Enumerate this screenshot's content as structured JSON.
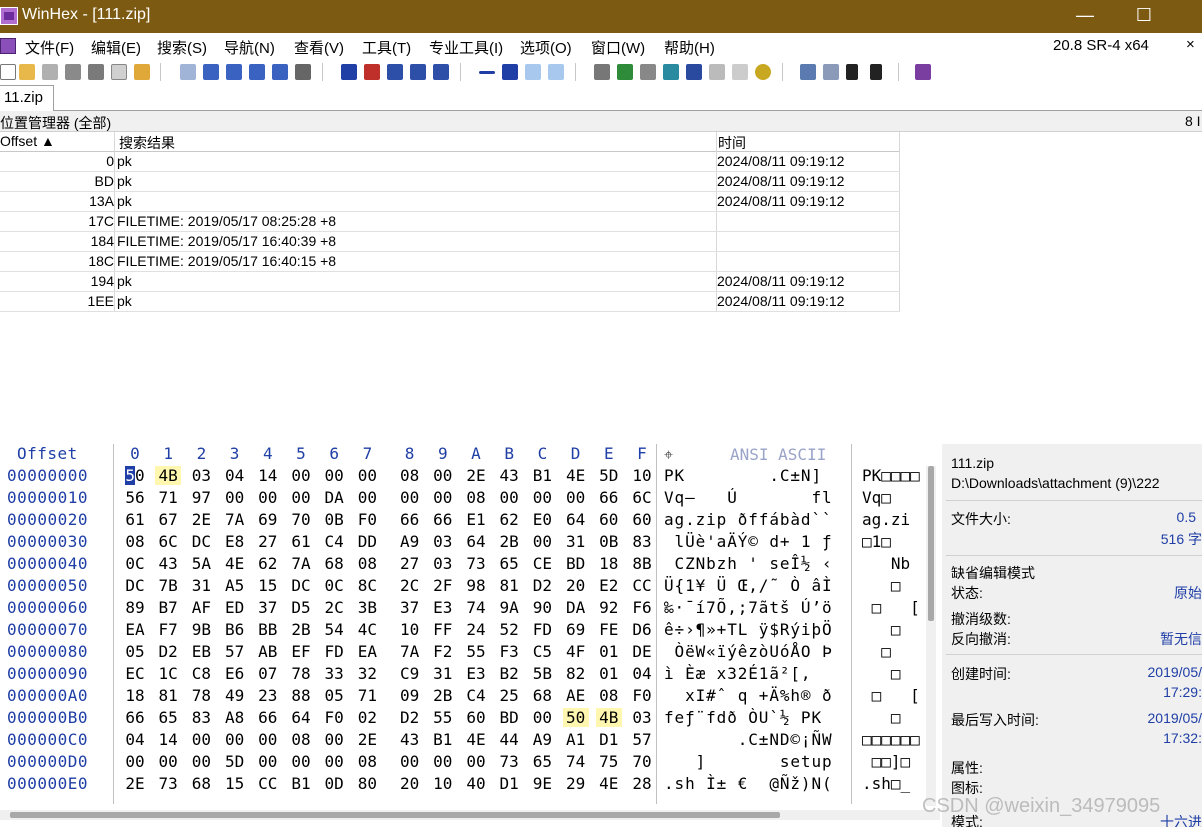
{
  "window": {
    "title": "WinHex - [111.zip]",
    "minimize": "—",
    "maximize": "☐",
    "close": "✕"
  },
  "menu": {
    "items": [
      "文件(F)",
      "编辑(E)",
      "搜索(S)",
      "导航(N)",
      "查看(V)",
      "工具(T)",
      "专业工具(I)",
      "选项(O)",
      "窗口(W)",
      "帮助(H)"
    ],
    "version": "20.8 SR-4 x64",
    "close": "×"
  },
  "toolbar": {
    "icons": [
      "new-file-icon",
      "open-icon",
      "save-icon",
      "print-icon",
      "properties-icon",
      "undo-icon",
      "copy-icon",
      "cut-icon",
      "paste-icon",
      "paste-special-icon",
      "block-icon",
      "find-icon",
      "find-replace-icon",
      "find-hex-icon",
      "replace-hex-icon",
      "find-next-icon",
      "goto-offset-icon",
      "goto-sector-icon",
      "back-icon",
      "forward-icon",
      "disk-editor-icon",
      "ram-editor-icon",
      "hash-icon",
      "calculator-icon",
      "search-tool-icon",
      "options-icon",
      "shield-icon",
      "gear-icon",
      "table-icon",
      "grid-icon",
      "prev-icon",
      "next-icon",
      "book-icon"
    ],
    "colors": {
      "accent_blue": "#1f3ea6",
      "accent_red": "#c0302b",
      "accent_green": "#2e8b3a",
      "purple": "#7a3ea0"
    }
  },
  "tab": {
    "label": "11.zip"
  },
  "position_manager": {
    "label": "位置管理器 (全部)",
    "count": "8 I",
    "columns": {
      "offset": "Offset ▲",
      "result": "搜索结果",
      "time": "时间"
    },
    "rows": [
      {
        "offset": "0",
        "result": "pk",
        "time": "2024/08/11  09:19:12"
      },
      {
        "offset": "BD",
        "result": "pk",
        "time": "2024/08/11  09:19:12"
      },
      {
        "offset": "13A",
        "result": "pk",
        "time": "2024/08/11  09:19:12"
      },
      {
        "offset": "17C",
        "result": "FILETIME: 2019/05/17  08:25:28  +8",
        "time": ""
      },
      {
        "offset": "184",
        "result": "FILETIME: 2019/05/17  16:40:39  +8",
        "time": ""
      },
      {
        "offset": "18C",
        "result": "FILETIME: 2019/05/17  16:40:15  +8",
        "time": ""
      },
      {
        "offset": "194",
        "result": "pk",
        "time": "2024/08/11  09:19:12"
      },
      {
        "offset": "1EE",
        "result": "pk",
        "time": "2024/08/11  09:19:12"
      }
    ]
  },
  "hex": {
    "offset_label": "Offset",
    "columns": [
      "0",
      "1",
      "2",
      "3",
      "4",
      "5",
      "6",
      "7",
      "8",
      "9",
      "A",
      "B",
      "C",
      "D",
      "E",
      "F"
    ],
    "ansi_label": "ANSI ASCII",
    "crosshair": "⌖",
    "rows": [
      {
        "offset": "00000000",
        "bytes": [
          "50",
          "4B",
          "03",
          "04",
          "14",
          "00",
          "00",
          "00",
          "08",
          "00",
          "2E",
          "43",
          "B1",
          "4E",
          "5D",
          "10"
        ],
        "ansi": "PK        .C±N]",
        "ascii": "PK□□□□"
      },
      {
        "offset": "00000010",
        "bytes": [
          "56",
          "71",
          "97",
          "00",
          "00",
          "00",
          "DA",
          "00",
          "00",
          "00",
          "08",
          "00",
          "00",
          "00",
          "66",
          "6C"
        ],
        "ansi": "Vq—   Ú       fl",
        "ascii": "Vq□"
      },
      {
        "offset": "00000020",
        "bytes": [
          "61",
          "67",
          "2E",
          "7A",
          "69",
          "70",
          "0B",
          "F0",
          "66",
          "66",
          "E1",
          "62",
          "E0",
          "64",
          "60",
          "60"
        ],
        "ansi": "ag.zip ðffábàd``",
        "ascii": "ag.zi"
      },
      {
        "offset": "00000030",
        "bytes": [
          "08",
          "6C",
          "DC",
          "E8",
          "27",
          "61",
          "C4",
          "DD",
          "A9",
          "03",
          "64",
          "2B",
          "00",
          "31",
          "0B",
          "83"
        ],
        "ansi": " lÜè'aÄÝ© d+ 1 ƒ",
        "ascii": "□1□"
      },
      {
        "offset": "00000040",
        "bytes": [
          "0C",
          "43",
          "5A",
          "4E",
          "62",
          "7A",
          "68",
          "08",
          "27",
          "03",
          "73",
          "65",
          "CE",
          "BD",
          "18",
          "8B"
        ],
        "ansi": " CZNbzh ' seÎ½ ‹",
        "ascii": "   Nb"
      },
      {
        "offset": "00000050",
        "bytes": [
          "DC",
          "7B",
          "31",
          "A5",
          "15",
          "DC",
          "0C",
          "8C",
          "2C",
          "2F",
          "98",
          "81",
          "D2",
          "20",
          "E2",
          "CC"
        ],
        "ansi": "Ü{1¥ Ü Œ,/˜ Ò âÌ",
        "ascii": "   □"
      },
      {
        "offset": "00000060",
        "bytes": [
          "89",
          "B7",
          "AF",
          "ED",
          "37",
          "D5",
          "2C",
          "3B",
          "37",
          "E3",
          "74",
          "9A",
          "90",
          "DA",
          "92",
          "F6"
        ],
        "ansi": "‰·¯í7Õ,;7ãtš Ú’ö",
        "ascii": " □   ["
      },
      {
        "offset": "00000070",
        "bytes": [
          "EA",
          "F7",
          "9B",
          "B6",
          "BB",
          "2B",
          "54",
          "4C",
          "10",
          "FF",
          "24",
          "52",
          "FD",
          "69",
          "FE",
          "D6"
        ],
        "ansi": "ê÷›¶»+TL ÿ$RýiþÖ",
        "ascii": "   □"
      },
      {
        "offset": "00000080",
        "bytes": [
          "05",
          "D2",
          "EB",
          "57",
          "AB",
          "EF",
          "FD",
          "EA",
          "7A",
          "F2",
          "55",
          "F3",
          "C5",
          "4F",
          "01",
          "DE"
        ],
        "ansi": " ÒëW«ïýêzòUóÅO Þ",
        "ascii": "  □"
      },
      {
        "offset": "00000090",
        "bytes": [
          "EC",
          "1C",
          "C8",
          "E6",
          "07",
          "78",
          "33",
          "32",
          "C9",
          "31",
          "E3",
          "B2",
          "5B",
          "82",
          "01",
          "04"
        ],
        "ansi": "ì Èæ x32É1ã²[‚  ",
        "ascii": "   □"
      },
      {
        "offset": "000000A0",
        "bytes": [
          "18",
          "81",
          "78",
          "49",
          "23",
          "88",
          "05",
          "71",
          "09",
          "2B",
          "C4",
          "25",
          "68",
          "AE",
          "08",
          "F0"
        ],
        "ansi": "  xI#ˆ q +Ä%h® ð",
        "ascii": " □   ["
      },
      {
        "offset": "000000B0",
        "bytes": [
          "66",
          "65",
          "83",
          "A8",
          "66",
          "64",
          "F0",
          "02",
          "D2",
          "55",
          "60",
          "BD",
          "00",
          "50",
          "4B",
          "03"
        ],
        "ansi": "feƒ¨fdð ÒU`½ PK ",
        "ascii": "   □"
      },
      {
        "offset": "000000C0",
        "bytes": [
          "04",
          "14",
          "00",
          "00",
          "00",
          "08",
          "00",
          "2E",
          "43",
          "B1",
          "4E",
          "44",
          "A9",
          "A1",
          "D1",
          "57"
        ],
        "ansi": "       .C±ND©¡ÑW",
        "ascii": "□□□□□□"
      },
      {
        "offset": "000000D0",
        "bytes": [
          "00",
          "00",
          "00",
          "5D",
          "00",
          "00",
          "00",
          "08",
          "00",
          "00",
          "00",
          "73",
          "65",
          "74",
          "75",
          "70"
        ],
        "ansi": "   ]       setup",
        "ascii": " □□]□"
      },
      {
        "offset": "000000E0",
        "bytes": [
          "2E",
          "73",
          "68",
          "15",
          "CC",
          "B1",
          "0D",
          "80",
          "20",
          "10",
          "40",
          "D1",
          "9E",
          "29",
          "4E",
          "28"
        ],
        "ansi": ".sh Ì± €  @Ñž)N(",
        "ascii": ".sh□_"
      }
    ]
  },
  "info_panel": {
    "filename": "111.zip",
    "path": "D:\\Downloads\\attachment (9)\\222",
    "file_size_label": "文件大小:",
    "file_size_value": "0.5",
    "file_size_bytes": "516 字",
    "default_edit_mode": "缺省编辑模式",
    "state_label": "状态:",
    "state_value": "原始",
    "undo_level_label": "撤消级数:",
    "undo_reverse_label": "反向撤消:",
    "undo_reverse_value": "暂无信",
    "created_label": "创建时间:",
    "created_date": "2019/05/",
    "created_time": "17:29:",
    "modified_label": "最后写入时间:",
    "modified_date": "2019/05/",
    "modified_time": "17:32:",
    "attributes_label": "属性:",
    "icon_label": "图标:",
    "mode_label": "模式:",
    "mode_value": "十六进"
  },
  "watermark": "CSDN @weixin_34979095"
}
